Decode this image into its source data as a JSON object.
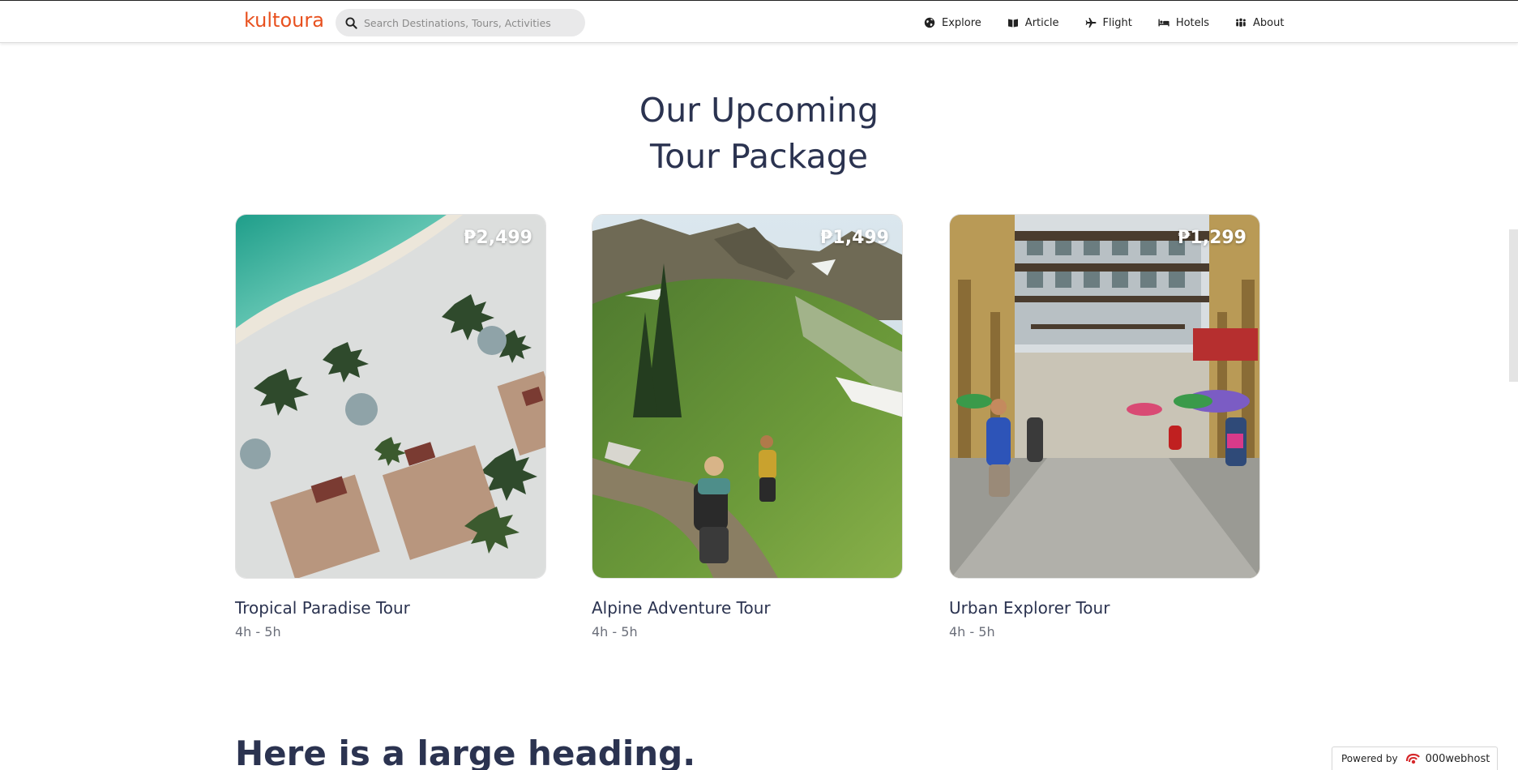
{
  "header": {
    "logo": "kultoura",
    "search_placeholder": "Search Destinations, Tours, Activities",
    "nav": [
      {
        "label": "Explore",
        "icon": "globe-icon"
      },
      {
        "label": "Article",
        "icon": "book-icon"
      },
      {
        "label": "Flight",
        "icon": "plane-icon"
      },
      {
        "label": "Hotels",
        "icon": "bed-icon"
      },
      {
        "label": "About",
        "icon": "people-icon"
      }
    ]
  },
  "section": {
    "title_line1": "Our Upcoming",
    "title_line2": "Tour Package"
  },
  "tours": [
    {
      "name": "Tropical Paradise Tour",
      "duration": "4h - 5h",
      "price": "₱2,499"
    },
    {
      "name": "Alpine Adventure Tour",
      "duration": "4h - 5h",
      "price": "₱1,499"
    },
    {
      "name": "Urban Explorer Tour",
      "duration": "4h - 5h",
      "price": "₱1,299"
    }
  ],
  "next_section": {
    "heading": "Here is a large heading."
  },
  "footer_badge": {
    "prefix": "Powered by",
    "brand": "000webhost"
  },
  "colors": {
    "logo": "#e8511f",
    "heading": "#2b3350",
    "search_bg": "#e9e9ea"
  }
}
